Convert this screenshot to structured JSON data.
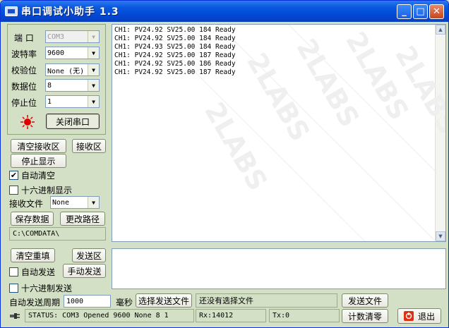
{
  "window": {
    "title": "串口调试小助手 1.3",
    "btn_min": "_",
    "btn_max": "□",
    "btn_close": "✕"
  },
  "settings": {
    "port_label": "端  口",
    "port_value": "COM3",
    "baud_label": "波特率",
    "baud_value": "9600",
    "parity_label": "校验位",
    "parity_value": "None (无)",
    "databits_label": "数据位",
    "databits_value": "8",
    "stopbits_label": "停止位",
    "stopbits_value": "1",
    "close_port_label": "关闭串口"
  },
  "receive_controls": {
    "clear_recv_label": "清空接收区",
    "recv_area_label": "接收区",
    "stop_display_label": "停止显示",
    "auto_clear_label": "自动清空",
    "auto_clear_checked": "✔",
    "hex_display_label": "十六进制显示",
    "hex_display_checked": "",
    "recv_file_label": "接收文件",
    "recv_file_value": "None",
    "save_data_label": "保存数据",
    "change_path_label": "更改路径",
    "path_value": "C:\\COMDATA\\"
  },
  "receive_text": "CH1: PV24.92 SV25.00 184 Ready\nCH1: PV24.92 SV25.00 184 Ready\nCH1: PV24.93 SV25.00 184 Ready\nCH1: PV24.92 SV25.00 187 Ready\nCH1: PV24.92 SV25.00 186 Ready\nCH1: PV24.92 SV25.00 187 Ready",
  "send_controls": {
    "clear_resend_label": "清空重填",
    "send_area_label": "发送区",
    "auto_send_label": "自动发送",
    "auto_send_checked": "",
    "manual_send_label": "手动发送",
    "hex_send_label": "十六进制发送",
    "hex_send_checked": "",
    "auto_period_label": "自动发送周期",
    "auto_period_value": "1000",
    "ms_label": "毫秒",
    "choose_file_label": "选择发送文件",
    "file_status": "还没有选择文件",
    "send_file_label": "发送文件"
  },
  "statusbar": {
    "status_text": "STATUS: COM3 Opened 9600 None  8 1",
    "rx_text": "Rx:14012",
    "tx_text": "Tx:0",
    "counter_clear_label": "计数清零",
    "exit_label": "退出"
  },
  "colors": {
    "window_bg": "#d4e0c6",
    "titlebar": "#0147d3",
    "indicator": "#e00000"
  }
}
